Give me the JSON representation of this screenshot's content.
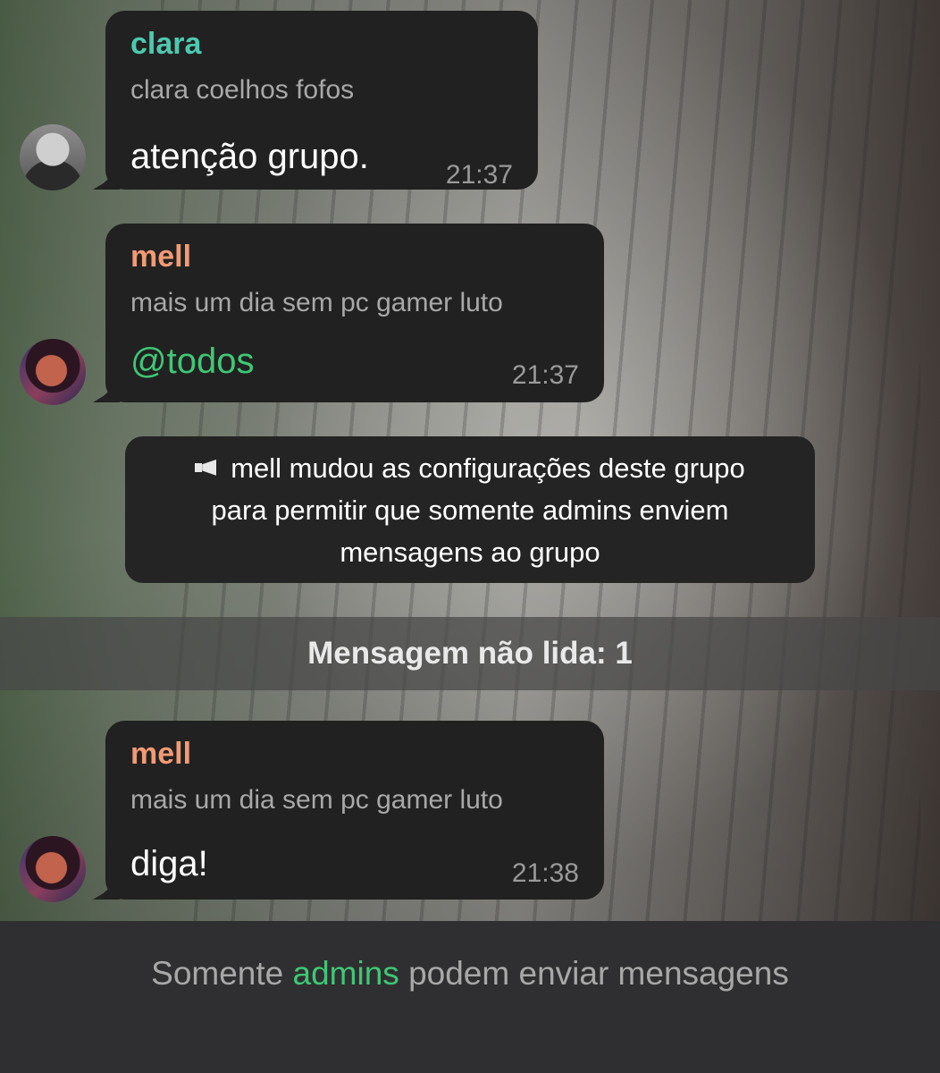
{
  "messages": [
    {
      "sender": "clara",
      "reply_preview": "clara coelhos fofos",
      "text": "atenção grupo.",
      "time": "21:37"
    },
    {
      "sender": "mell",
      "reply_preview": "mais um dia sem pc gamer luto",
      "text": "@todos",
      "time": "21:37"
    },
    {
      "sender": "mell",
      "reply_preview": "mais um dia sem pc gamer luto",
      "text": "diga!",
      "time": "21:38"
    }
  ],
  "service_message": {
    "icon": "megaphone-icon",
    "line1": "mell mudou as configurações deste grupo",
    "line2": "para permitir que somente admins enviem",
    "line3": "mensagens ao grupo"
  },
  "unread_bar": {
    "label": "Mensagem não lida: 1"
  },
  "footer": {
    "prefix": "Somente",
    "highlight": "admins",
    "suffix": "podem enviar mensagens"
  },
  "colors": {
    "bubble": "#212121",
    "sender_clara": "#4cc9b0",
    "sender_mell": "#f29a74",
    "accent_green": "#3fc775",
    "timestamp": "#9a9a9a"
  }
}
